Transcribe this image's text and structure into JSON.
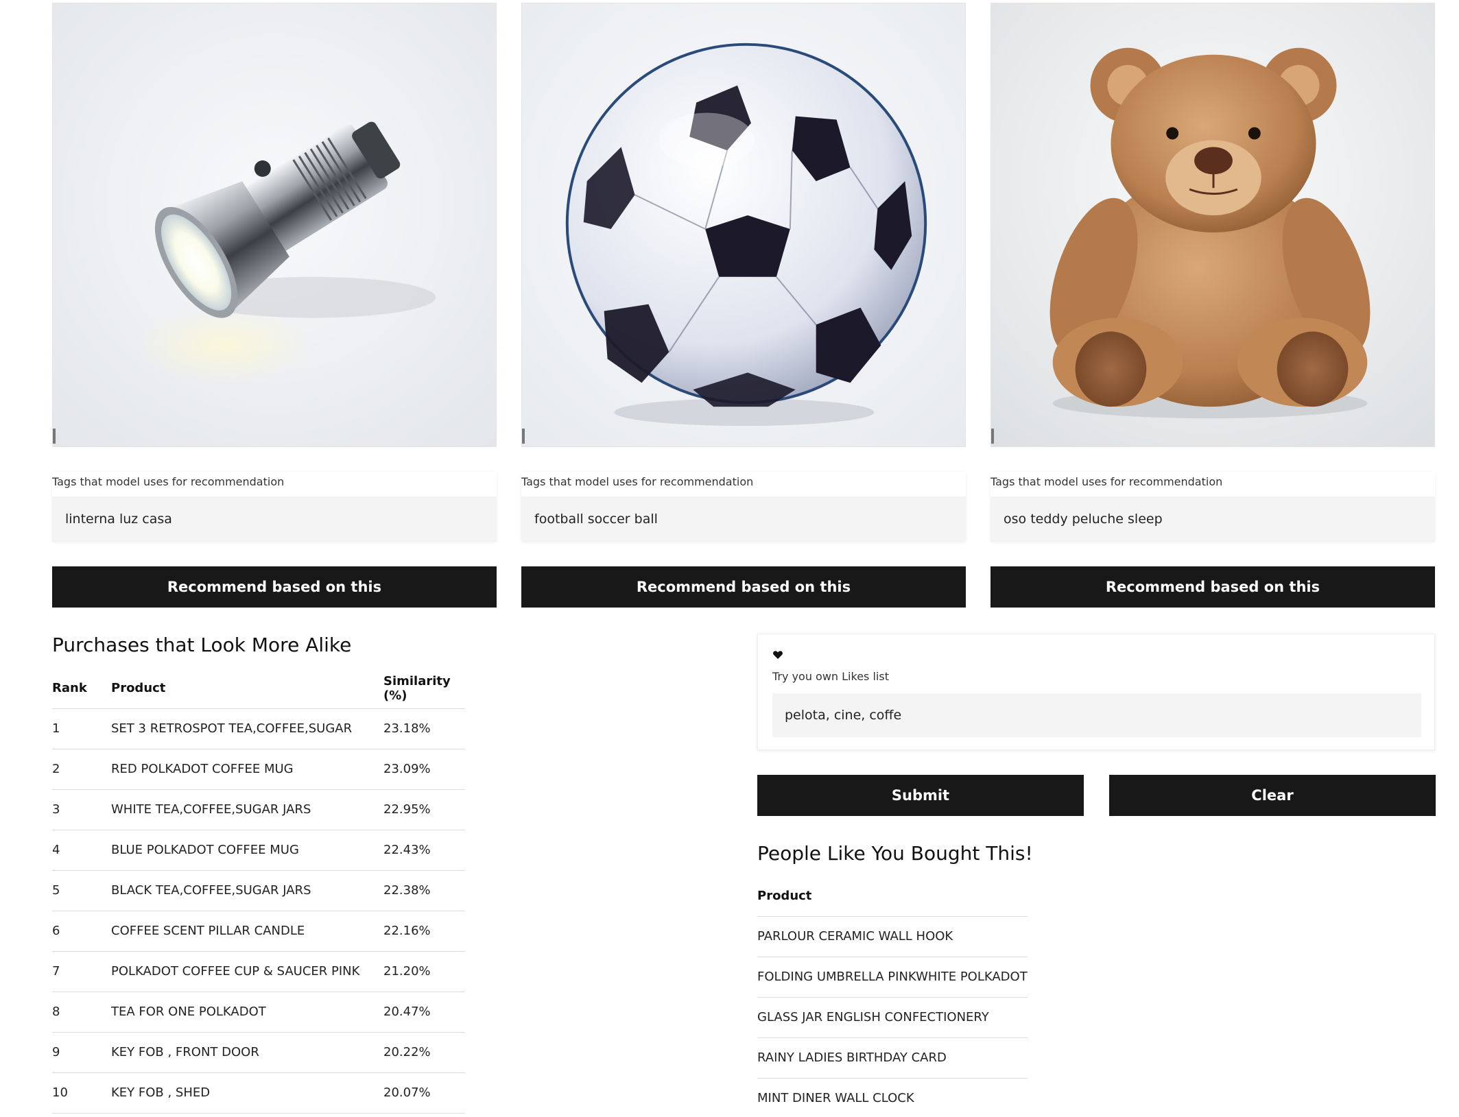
{
  "cards": [
    {
      "image_subject": "flashlight",
      "tag_label": "Tags that model uses for recommendation",
      "tags_value": "linterna luz casa",
      "button_label": "Recommend based on this"
    },
    {
      "image_subject": "soccer ball",
      "tag_label": "Tags that model uses for recommendation",
      "tags_value": "football soccer ball",
      "button_label": "Recommend based on this"
    },
    {
      "image_subject": "teddy bear",
      "tag_label": "Tags that model uses for recommendation",
      "tags_value": "oso teddy peluche sleep",
      "button_label": "Recommend based on this"
    }
  ],
  "similar": {
    "title": "Purchases that Look More Alike",
    "headers": [
      "Rank",
      "Product",
      "Similarity (%)"
    ],
    "rows": [
      [
        "1",
        "SET 3 RETROSPOT TEA,COFFEE,SUGAR",
        "23.18%"
      ],
      [
        "2",
        "RED POLKADOT COFFEE MUG",
        "23.09%"
      ],
      [
        "3",
        "WHITE TEA,COFFEE,SUGAR JARS",
        "22.95%"
      ],
      [
        "4",
        "BLUE POLKADOT COFFEE MUG",
        "22.43%"
      ],
      [
        "5",
        "BLACK TEA,COFFEE,SUGAR JARS",
        "22.38%"
      ],
      [
        "6",
        "COFFEE SCENT PILLAR CANDLE",
        "22.16%"
      ],
      [
        "7",
        "POLKADOT COFFEE CUP & SAUCER PINK",
        "21.20%"
      ],
      [
        "8",
        "TEA FOR ONE POLKADOT",
        "20.47%"
      ],
      [
        "9",
        "KEY FOB , FRONT DOOR",
        "20.22%"
      ],
      [
        "10",
        "KEY FOB , SHED",
        "20.07%"
      ]
    ]
  },
  "likes": {
    "icon": "heart-icon",
    "label": "Try you own Likes list",
    "value": "pelota, cine, coffe",
    "submit_label": "Submit",
    "clear_label": "Clear"
  },
  "people": {
    "title": "People Like You Bought This!",
    "header": "Product",
    "rows": [
      "PARLOUR CERAMIC WALL HOOK",
      "FOLDING UMBRELLA PINKWHITE POLKADOT",
      "GLASS JAR ENGLISH CONFECTIONERY",
      "RAINY LADIES BIRTHDAY CARD",
      "MINT DINER WALL CLOCK"
    ]
  },
  "colors": {
    "button_bg": "#181818",
    "button_text": "#ffffff",
    "input_bg": "#f4f4f4"
  }
}
